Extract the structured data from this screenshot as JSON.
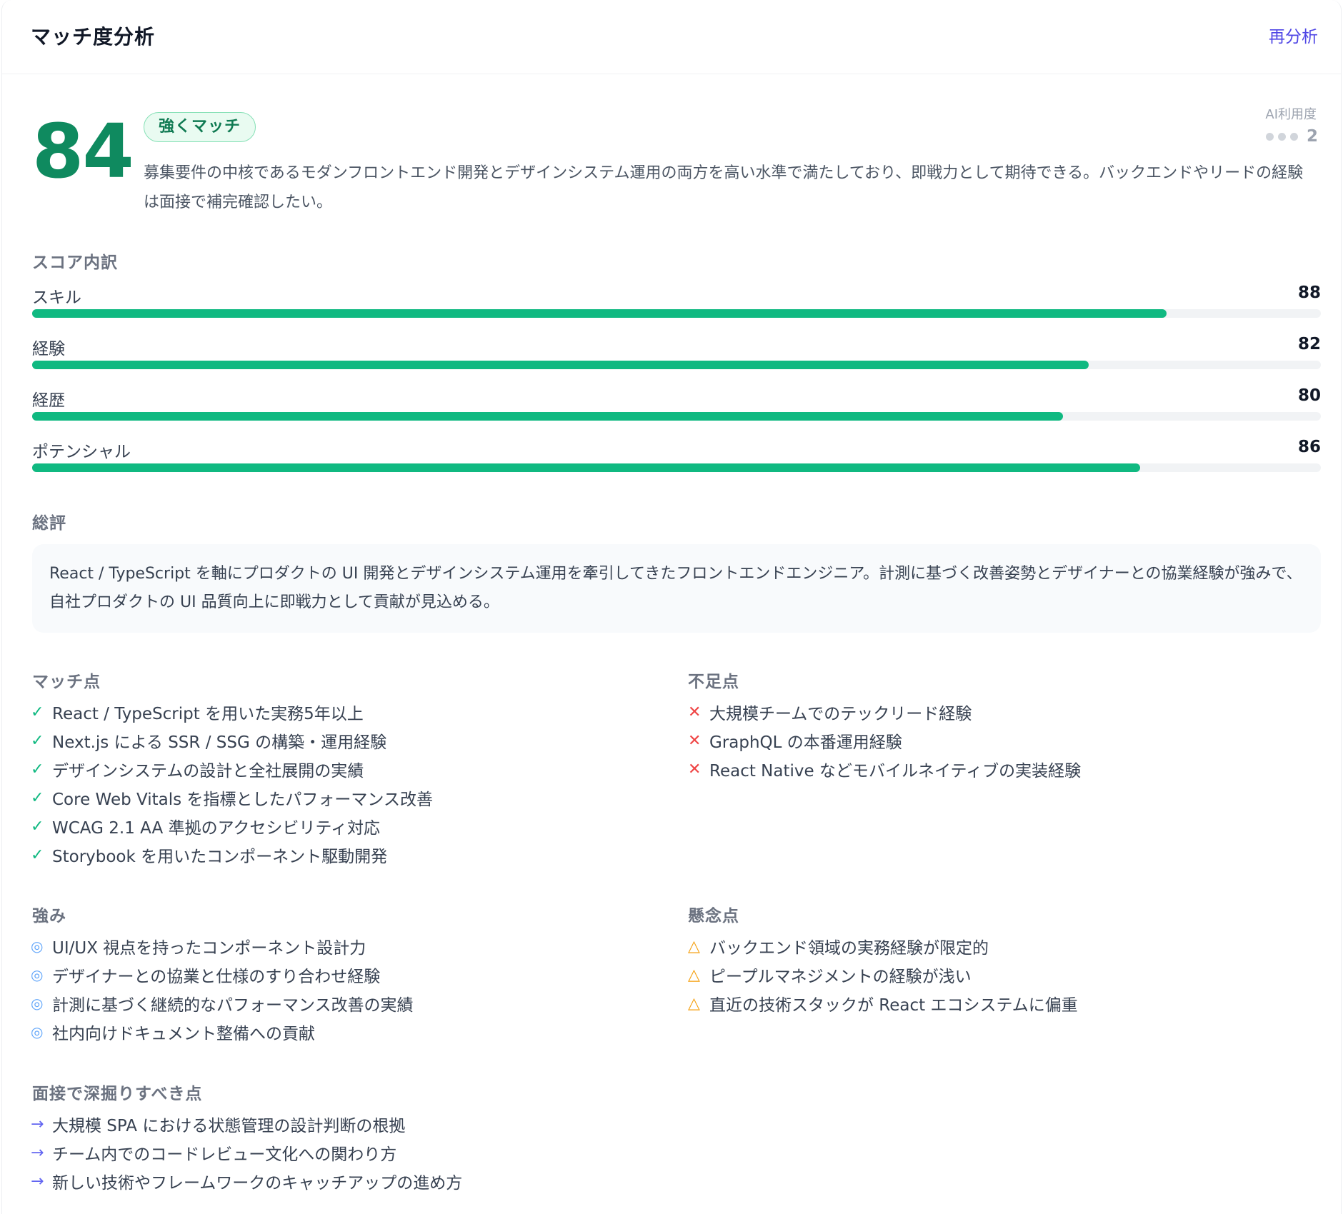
{
  "header": {
    "title": "マッチ度分析",
    "reanalyze_label": "再分析"
  },
  "score": {
    "value": "84",
    "badge": "強くマッチ",
    "summary": "募集要件の中核であるモダンフロントエンド開発とデザインシステム運用の両方を高い水準で満たしており、即戦力として期待できる。バックエンドやリードの経験は面接で補完確認したい。"
  },
  "ai_usage": {
    "label": "AI利用度",
    "value": "2"
  },
  "breakdown": {
    "heading": "スコア内訳",
    "items": [
      {
        "label": "スキル",
        "value": "88",
        "percent": 88
      },
      {
        "label": "経験",
        "value": "82",
        "percent": 82
      },
      {
        "label": "経歴",
        "value": "80",
        "percent": 80
      },
      {
        "label": "ポテンシャル",
        "value": "86",
        "percent": 86
      }
    ]
  },
  "overall": {
    "heading": "総評",
    "text": "React / TypeScript を軸にプロダクトの UI 開発とデザインシステム運用を牽引してきたフロントエンドエンジニア。計測に基づく改善姿勢とデザイナーとの協業経験が強みで、自社プロダクトの UI 品質向上に即戦力として貢献が見込める。"
  },
  "match_points": {
    "heading": "マッチ点",
    "marker": "✓",
    "items": [
      "React / TypeScript を用いた実務5年以上",
      "Next.js による SSR / SSG の構築・運用経験",
      "デザインシステムの設計と全社展開の実績",
      "Core Web Vitals を指標としたパフォーマンス改善",
      "WCAG 2.1 AA 準拠のアクセシビリティ対応",
      "Storybook を用いたコンポーネント駆動開発"
    ]
  },
  "gaps": {
    "heading": "不足点",
    "marker": "✕",
    "items": [
      "大規模チームでのテックリード経験",
      "GraphQL の本番運用経験",
      "React Native などモバイルネイティブの実装経験"
    ]
  },
  "strengths": {
    "heading": "強み",
    "marker": "◎",
    "items": [
      "UI/UX 視点を持ったコンポーネント設計力",
      "デザイナーとの協業と仕様のすり合わせ経験",
      "計測に基づく継続的なパフォーマンス改善の実績",
      "社内向けドキュメント整備への貢献"
    ]
  },
  "concerns": {
    "heading": "懸念点",
    "marker": "△",
    "items": [
      "バックエンド領域の実務経験が限定的",
      "ピープルマネジメントの経験が浅い",
      "直近の技術スタックが React エコシステムに偏重"
    ]
  },
  "interview": {
    "heading": "面接で深掘りすべき点",
    "marker": "→",
    "items": [
      "大規模 SPA における状態管理の設計判断の根拠",
      "チーム内でのコードレビュー文化への関わり方",
      "新しい技術やフレームワークのキャッチアップの進め方"
    ]
  },
  "colors": {
    "score": "#0f8a5f",
    "bar_fill": "#10b981",
    "bar_track": "#f1f3f5",
    "accent_link": "#4f46e5",
    "check": "#10b981",
    "cross": "#ef4444",
    "circle": "#60a5fa",
    "warn": "#f59e0b",
    "arrow": "#6366f1"
  }
}
